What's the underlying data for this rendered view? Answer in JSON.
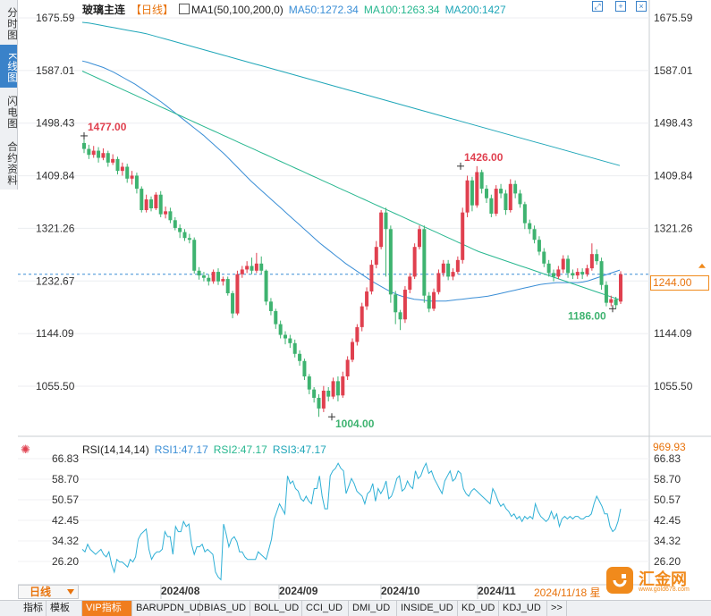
{
  "sidebar": {
    "tabs": [
      {
        "label": "分时图",
        "active": false
      },
      {
        "label": "K线图",
        "active": true
      },
      {
        "label": "闪电图",
        "active": false
      },
      {
        "label": "合约资料",
        "active": false
      }
    ]
  },
  "header": {
    "symbol": "玻璃主连",
    "period": "【日线】",
    "ma_label": "MA1(50,100,200,0)",
    "ma50": "MA50:1272.34",
    "ma100": "MA100:1263.34",
    "ma200": "MA200:1427"
  },
  "rsi_header": {
    "label": "RSI(14,14,14)",
    "rsi1": "RSI1:47.17",
    "rsi2": "RSI2:47.17",
    "rsi3": "RSI3:47.17"
  },
  "current_price": "1244.00",
  "rsi_top_value": "969.93",
  "period_selector": "日线",
  "date_cursor": "2024/11/18 星",
  "bottom_tabs": [
    "指标",
    "模板",
    "VIP指标",
    "BARUPDN_UD",
    "BIAS_UD",
    "BOLL_UD",
    "CCI_UD",
    "DMI_UD",
    "INSIDE_UD",
    "KD_UD",
    "KDJ_UD",
    ">>"
  ],
  "logo": {
    "text": "汇金网",
    "url": "www.gold678.com"
  },
  "colors": {
    "up": "#e0404f",
    "down": "#3eb370",
    "ma50": "#3a8ed6",
    "ma100": "#27b78f",
    "ma200": "#1fa6b8",
    "rsi": "#2fb0d6",
    "accent": "#f08a1c"
  },
  "chart_data": {
    "type": "candlestick",
    "y_axis": {
      "ticks": [
        1675.59,
        1587.01,
        1498.43,
        1409.84,
        1321.26,
        1232.67,
        1144.09,
        1055.5
      ],
      "range": [
        990,
        1720
      ]
    },
    "x_axis": {
      "ticks": [
        "2024/08",
        "2024/09",
        "2024/10",
        "2024/11"
      ]
    },
    "annotations": [
      {
        "label": "1477.00",
        "type": "high"
      },
      {
        "label": "1426.00",
        "type": "high"
      },
      {
        "label": "1004.00",
        "type": "low"
      },
      {
        "label": "1186.00",
        "type": "low"
      }
    ],
    "series": [
      {
        "name": "MA50",
        "values": [
          1603,
          1601,
          1598,
          1595,
          1592,
          1588,
          1584,
          1579,
          1574,
          1569,
          1564,
          1558,
          1552,
          1546,
          1540,
          1534,
          1527,
          1520,
          1513,
          1506,
          1499,
          1492,
          1485,
          1478,
          1470,
          1462,
          1454,
          1446,
          1437,
          1428,
          1419,
          1410,
          1401,
          1393,
          1385,
          1377,
          1369,
          1361,
          1353,
          1345,
          1337,
          1329,
          1321,
          1313,
          1305,
          1297,
          1290,
          1283,
          1276,
          1269,
          1262,
          1256,
          1250,
          1244,
          1238,
          1232,
          1227,
          1222,
          1217,
          1213,
          1209,
          1206,
          1204,
          1202,
          1201,
          1200,
          1199,
          1199,
          1199,
          1199,
          1200,
          1201,
          1202,
          1203,
          1204,
          1205,
          1206,
          1207,
          1209,
          1211,
          1213,
          1215,
          1217,
          1219,
          1221,
          1223,
          1225,
          1227,
          1228,
          1229,
          1230,
          1230,
          1230,
          1230,
          1230,
          1231,
          1233,
          1236,
          1239,
          1242,
          1245,
          1248,
          1251
        ]
      },
      {
        "name": "MA100",
        "values": [
          1586,
          1582,
          1578,
          1574,
          1570,
          1566,
          1562,
          1558,
          1554,
          1550,
          1546,
          1542,
          1538,
          1534,
          1530,
          1526,
          1522,
          1518,
          1514,
          1510,
          1506,
          1502,
          1498,
          1494,
          1490,
          1486,
          1482,
          1478,
          1474,
          1470,
          1466,
          1462,
          1458,
          1454,
          1450,
          1446,
          1442,
          1438,
          1434,
          1430,
          1426,
          1422,
          1418,
          1414,
          1410,
          1406,
          1402,
          1398,
          1394,
          1390,
          1386,
          1382,
          1378,
          1374,
          1370,
          1366,
          1362,
          1358,
          1354,
          1350,
          1346,
          1342,
          1338,
          1334,
          1330,
          1326,
          1322,
          1318,
          1314,
          1310,
          1306,
          1302,
          1298,
          1294,
          1290,
          1286,
          1282,
          1279,
          1276,
          1273,
          1270,
          1267,
          1264,
          1261,
          1258,
          1255,
          1252,
          1249,
          1246,
          1243,
          1240,
          1237,
          1234,
          1231,
          1228,
          1225,
          1222,
          1219,
          1216,
          1213,
          1210,
          1207,
          1204,
          1201
        ]
      },
      {
        "name": "MA200",
        "values": [
          1668,
          1667,
          1665,
          1663,
          1661,
          1659,
          1657,
          1655,
          1653,
          1651,
          1649,
          1646,
          1643,
          1640,
          1637,
          1634,
          1631,
          1628,
          1625,
          1622,
          1619,
          1616,
          1613,
          1610,
          1607,
          1604,
          1601,
          1598,
          1595,
          1592,
          1589,
          1586,
          1583,
          1580,
          1577,
          1574,
          1571,
          1568,
          1565,
          1562,
          1559,
          1556,
          1553,
          1550,
          1547,
          1544,
          1541,
          1538,
          1535,
          1532,
          1529,
          1526,
          1523,
          1520,
          1517,
          1514,
          1511,
          1508,
          1505,
          1502,
          1499,
          1496,
          1493,
          1490,
          1487,
          1484,
          1481,
          1478,
          1475,
          1472,
          1469,
          1466,
          1463,
          1460,
          1457,
          1454,
          1451,
          1448,
          1445,
          1442,
          1439,
          1436,
          1433,
          1430,
          1427
        ]
      },
      {
        "name": "RSI",
        "values": [
          31,
          30,
          33,
          31,
          30,
          29,
          30,
          31,
          29,
          28,
          30,
          25,
          22,
          27,
          26,
          26,
          25,
          24,
          27,
          26,
          28,
          35,
          37,
          38,
          39,
          31,
          27,
          29,
          30,
          30,
          31,
          38,
          36,
          36,
          29,
          40,
          38,
          38,
          42,
          40,
          41,
          33,
          29,
          32,
          32,
          33,
          30,
          31,
          30,
          29,
          22,
          20,
          19,
          41,
          37,
          32,
          35,
          36,
          34,
          30,
          30,
          28,
          27,
          27,
          27,
          27,
          30,
          29,
          28,
          27,
          31,
          35,
          43,
          46,
          49,
          47,
          45,
          60,
          57,
          58,
          55,
          54,
          51,
          50,
          52,
          50,
          49,
          55,
          55,
          60,
          52,
          47,
          47,
          60,
          62,
          63,
          65,
          63,
          62,
          53,
          56,
          59,
          57,
          54,
          53,
          52,
          49,
          53,
          54,
          57,
          50,
          55,
          53,
          55,
          58,
          51,
          52,
          55,
          59,
          60,
          54,
          55,
          58,
          56,
          55,
          62,
          59,
          60,
          63,
          65,
          61,
          62,
          59,
          57,
          55,
          53,
          58,
          60,
          62,
          58,
          59,
          62,
          61,
          55,
          53,
          52,
          54,
          55,
          54,
          53,
          52,
          51,
          50,
          49,
          55,
          53,
          50,
          48,
          49,
          47,
          46,
          44,
          45,
          43,
          44,
          42,
          44,
          43,
          44,
          43,
          49,
          46,
          44,
          43,
          42,
          43,
          46,
          43,
          45,
          40,
          43,
          44,
          43,
          44,
          43,
          44,
          44,
          43,
          43,
          44,
          44,
          45,
          49,
          52,
          50,
          48,
          45,
          45,
          40,
          38,
          39,
          42,
          47
        ]
      }
    ],
    "candles": [
      [
        1465,
        1455,
        1477,
        1448
      ],
      [
        1455,
        1445,
        1462,
        1438
      ],
      [
        1445,
        1452,
        1460,
        1440
      ],
      [
        1452,
        1440,
        1458,
        1432
      ],
      [
        1440,
        1448,
        1456,
        1436
      ],
      [
        1448,
        1432,
        1452,
        1425
      ],
      [
        1432,
        1438,
        1446,
        1428
      ],
      [
        1438,
        1418,
        1442,
        1412
      ],
      [
        1418,
        1425,
        1432,
        1410
      ],
      [
        1425,
        1405,
        1430,
        1398
      ],
      [
        1405,
        1410,
        1418,
        1395
      ],
      [
        1410,
        1388,
        1415,
        1380
      ],
      [
        1388,
        1352,
        1392,
        1348
      ],
      [
        1352,
        1370,
        1378,
        1348
      ],
      [
        1370,
        1355,
        1375,
        1350
      ],
      [
        1355,
        1378,
        1382,
        1352
      ],
      [
        1378,
        1345,
        1384,
        1340
      ],
      [
        1345,
        1350,
        1358,
        1338
      ],
      [
        1350,
        1335,
        1356,
        1330
      ],
      [
        1335,
        1322,
        1340,
        1318
      ],
      [
        1322,
        1315,
        1328,
        1305
      ],
      [
        1315,
        1305,
        1320,
        1300
      ],
      [
        1305,
        1302,
        1312,
        1296
      ],
      [
        1302,
        1250,
        1306,
        1245
      ],
      [
        1250,
        1242,
        1256,
        1235
      ],
      [
        1242,
        1238,
        1248,
        1232
      ],
      [
        1238,
        1232,
        1244,
        1225
      ],
      [
        1232,
        1248,
        1252,
        1228
      ],
      [
        1248,
        1232,
        1254,
        1226
      ],
      [
        1232,
        1236,
        1240,
        1225
      ],
      [
        1236,
        1212,
        1240,
        1208
      ],
      [
        1212,
        1178,
        1216,
        1170
      ],
      [
        1178,
        1244,
        1250,
        1175
      ],
      [
        1244,
        1252,
        1258,
        1238
      ],
      [
        1252,
        1258,
        1266,
        1246
      ],
      [
        1258,
        1250,
        1272,
        1244
      ],
      [
        1250,
        1262,
        1280,
        1246
      ],
      [
        1262,
        1250,
        1274,
        1244
      ],
      [
        1250,
        1198,
        1252,
        1192
      ],
      [
        1198,
        1182,
        1204,
        1175
      ],
      [
        1182,
        1160,
        1186,
        1152
      ],
      [
        1160,
        1142,
        1166,
        1136
      ],
      [
        1142,
        1136,
        1148,
        1126
      ],
      [
        1136,
        1128,
        1142,
        1120
      ],
      [
        1128,
        1110,
        1134,
        1104
      ],
      [
        1110,
        1098,
        1116,
        1090
      ],
      [
        1098,
        1072,
        1102,
        1066
      ],
      [
        1072,
        1050,
        1076,
        1042
      ],
      [
        1050,
        1036,
        1054,
        1028
      ],
      [
        1036,
        1018,
        1042,
        1004
      ],
      [
        1018,
        1048,
        1056,
        1012
      ],
      [
        1048,
        1038,
        1054,
        1030
      ],
      [
        1038,
        1064,
        1070,
        1034
      ],
      [
        1064,
        1040,
        1072,
        1030
      ],
      [
        1040,
        1072,
        1080,
        1036
      ],
      [
        1072,
        1100,
        1106,
        1066
      ],
      [
        1100,
        1130,
        1136,
        1096
      ],
      [
        1130,
        1155,
        1160,
        1124
      ],
      [
        1155,
        1190,
        1196,
        1148
      ],
      [
        1190,
        1215,
        1222,
        1184
      ],
      [
        1215,
        1260,
        1268,
        1210
      ],
      [
        1260,
        1290,
        1300,
        1254
      ],
      [
        1290,
        1348,
        1352,
        1286
      ],
      [
        1348,
        1320,
        1356,
        1240
      ],
      [
        1320,
        1210,
        1326,
        1196
      ],
      [
        1210,
        1180,
        1216,
        1160
      ],
      [
        1180,
        1168,
        1184,
        1150
      ],
      [
        1168,
        1218,
        1224,
        1162
      ],
      [
        1218,
        1240,
        1246,
        1212
      ],
      [
        1240,
        1290,
        1296,
        1236
      ],
      [
        1290,
        1320,
        1326,
        1286
      ],
      [
        1320,
        1208,
        1326,
        1196
      ],
      [
        1208,
        1186,
        1214,
        1180
      ],
      [
        1186,
        1214,
        1220,
        1182
      ],
      [
        1214,
        1246,
        1252,
        1210
      ],
      [
        1246,
        1262,
        1268,
        1240
      ],
      [
        1262,
        1240,
        1268,
        1234
      ],
      [
        1240,
        1248,
        1254,
        1234
      ],
      [
        1248,
        1268,
        1274,
        1244
      ],
      [
        1268,
        1348,
        1356,
        1262
      ],
      [
        1348,
        1402,
        1410,
        1340
      ],
      [
        1402,
        1360,
        1408,
        1350
      ],
      [
        1360,
        1416,
        1426,
        1356
      ],
      [
        1416,
        1388,
        1420,
        1380
      ],
      [
        1388,
        1372,
        1394,
        1364
      ],
      [
        1372,
        1346,
        1378,
        1340
      ],
      [
        1346,
        1388,
        1394,
        1342
      ],
      [
        1388,
        1380,
        1396,
        1372
      ],
      [
        1380,
        1352,
        1386,
        1344
      ],
      [
        1352,
        1396,
        1404,
        1348
      ],
      [
        1396,
        1380,
        1402,
        1372
      ],
      [
        1380,
        1362,
        1386,
        1356
      ],
      [
        1362,
        1330,
        1366,
        1320
      ],
      [
        1330,
        1320,
        1336,
        1312
      ],
      [
        1320,
        1302,
        1326,
        1296
      ],
      [
        1302,
        1282,
        1308,
        1276
      ],
      [
        1282,
        1262,
        1288,
        1256
      ],
      [
        1262,
        1246,
        1268,
        1240
      ],
      [
        1246,
        1240,
        1252,
        1232
      ],
      [
        1240,
        1252,
        1258,
        1236
      ],
      [
        1252,
        1270,
        1276,
        1246
      ],
      [
        1270,
        1246,
        1276,
        1238
      ],
      [
        1246,
        1242,
        1252,
        1236
      ],
      [
        1242,
        1248,
        1254,
        1236
      ],
      [
        1248,
        1244,
        1254,
        1236
      ],
      [
        1244,
        1254,
        1260,
        1240
      ],
      [
        1254,
        1278,
        1296,
        1250
      ],
      [
        1278,
        1266,
        1286,
        1260
      ],
      [
        1266,
        1226,
        1272,
        1218
      ],
      [
        1226,
        1196,
        1232,
        1190
      ],
      [
        1196,
        1202,
        1208,
        1190
      ],
      [
        1202,
        1192,
        1206,
        1186
      ],
      [
        1198,
        1244,
        1249,
        1194
      ]
    ]
  }
}
